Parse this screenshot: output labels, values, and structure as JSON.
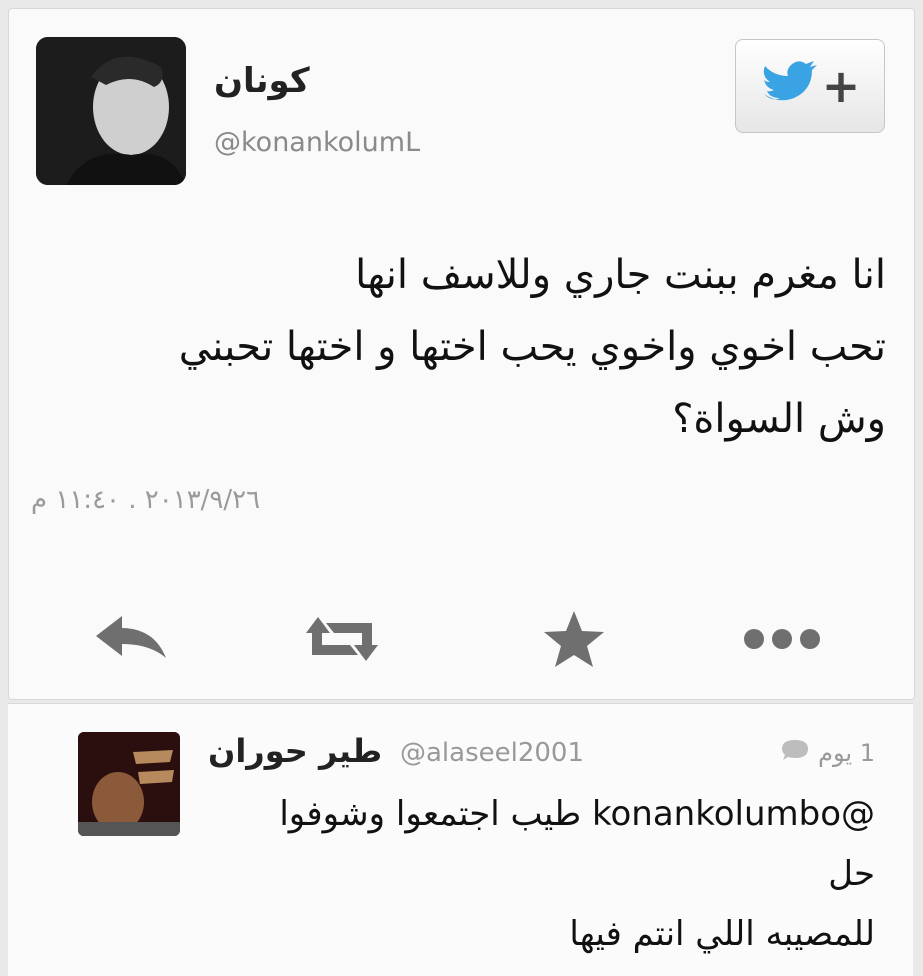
{
  "tweet": {
    "user_name": "كونان",
    "handle": "@konankolumL",
    "text_lines": [
      "انا مغرم ببنت جاري وللاسف انها",
      "تحب اخوي واخوي يحب اختها و اختها تحبني",
      "وش السواة؟"
    ],
    "timestamp": "٢٠١٣/٩/٢٦ . ١١:٤٠ م",
    "follow_icon": "twitter-bird-icon",
    "follow_plus": "+",
    "actions": [
      "reply-icon",
      "retweet-icon",
      "favorite-star-icon",
      "more-dots-icon"
    ]
  },
  "reply": {
    "user_name": "طير حوران",
    "handle": "@alaseel2001",
    "time": "1 يوم",
    "text_lines": [
      "@konankolumbo طيب اجتمعوا وشوفوا",
      "حل",
      "للمصيبه اللي انتم فيها"
    ]
  },
  "colors": {
    "icon_gray": "#6f6f6f",
    "twitter_blue": "#3aa3e3"
  }
}
